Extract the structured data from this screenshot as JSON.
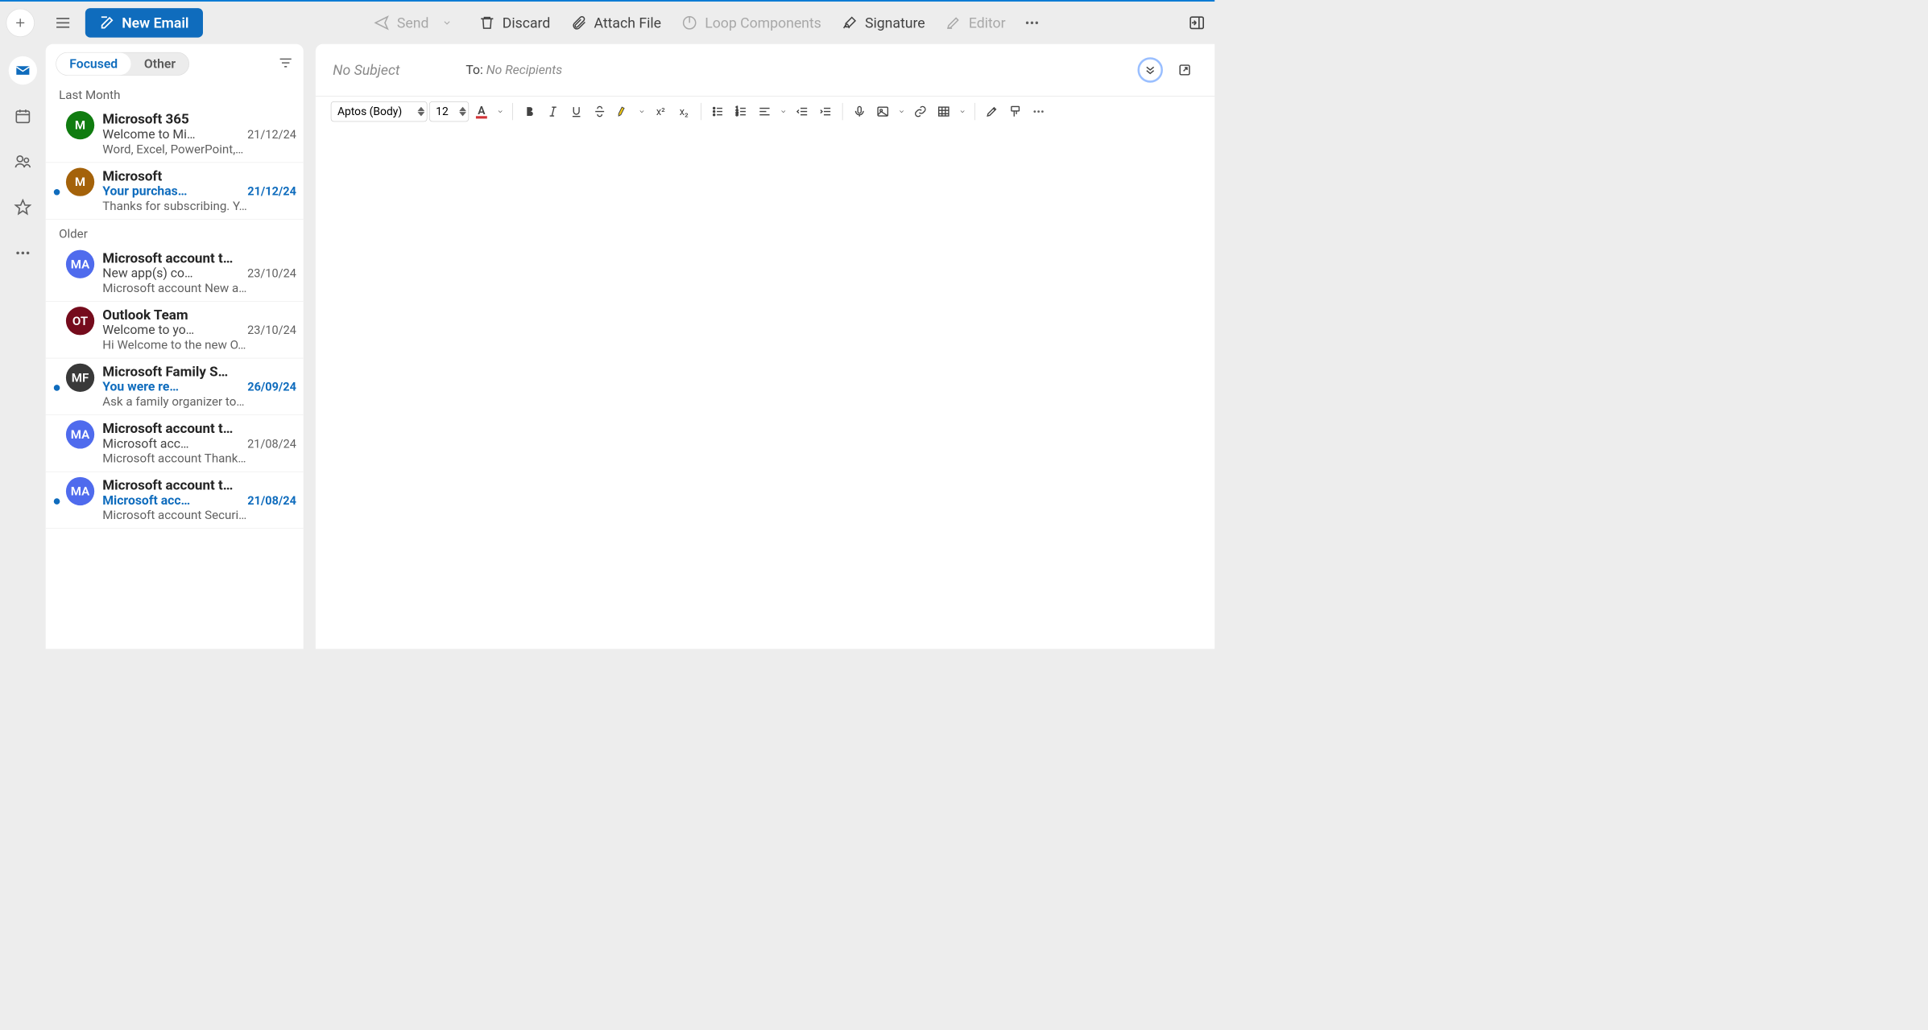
{
  "toolbar": {
    "new_email": "New Email",
    "send": "Send",
    "discard": "Discard",
    "attach": "Attach File",
    "loop": "Loop Components",
    "signature": "Signature",
    "editor": "Editor"
  },
  "tabs": {
    "focused": "Focused",
    "other": "Other"
  },
  "groups": {
    "last_month": "Last Month",
    "older": "Older"
  },
  "emails": [
    {
      "sender": "Microsoft 365",
      "subject": "Welcome to Mi…",
      "date": "21/12/24",
      "preview": "Word, Excel, PowerPoint,…",
      "avatar": "M",
      "color": "#107c10",
      "unread": false,
      "bold": true
    },
    {
      "sender": "Microsoft",
      "subject": "Your purchas…",
      "date": "21/12/24",
      "preview": "Thanks for subscribing. Y…",
      "avatar": "M",
      "color": "#a4620a",
      "unread": true,
      "bold": true
    },
    {
      "sender": "Microsoft account t…",
      "subject": "New app(s) co…",
      "date": "23/10/24",
      "preview": "Microsoft account New a…",
      "avatar": "MA",
      "color": "#4f6bed",
      "unread": false,
      "bold": true
    },
    {
      "sender": "Outlook Team",
      "subject": "Welcome to yo…",
      "date": "23/10/24",
      "preview": "Hi Welcome to the new O…",
      "avatar": "OT",
      "color": "#750b1c",
      "unread": false,
      "bold": true
    },
    {
      "sender": "Microsoft Family S…",
      "subject": "You were re…",
      "date": "26/09/24",
      "preview": "Ask a family organizer to…",
      "avatar": "MF",
      "color": "#393939",
      "unread": true,
      "bold": true
    },
    {
      "sender": "Microsoft account t…",
      "subject": "Microsoft acc…",
      "date": "21/08/24",
      "preview": "Microsoft account Thank…",
      "avatar": "MA",
      "color": "#4f6bed",
      "unread": false,
      "bold": true
    },
    {
      "sender": "Microsoft account t…",
      "subject": "Microsoft acc…",
      "date": "21/08/24",
      "preview": "Microsoft account Securi…",
      "avatar": "MA",
      "color": "#4f6bed",
      "unread": true,
      "bold": true
    }
  ],
  "compose": {
    "subject_placeholder": "No Subject",
    "to_label": "To:",
    "recipients_placeholder": "No Recipients",
    "font": "Aptos (Body)",
    "font_size": "12"
  }
}
